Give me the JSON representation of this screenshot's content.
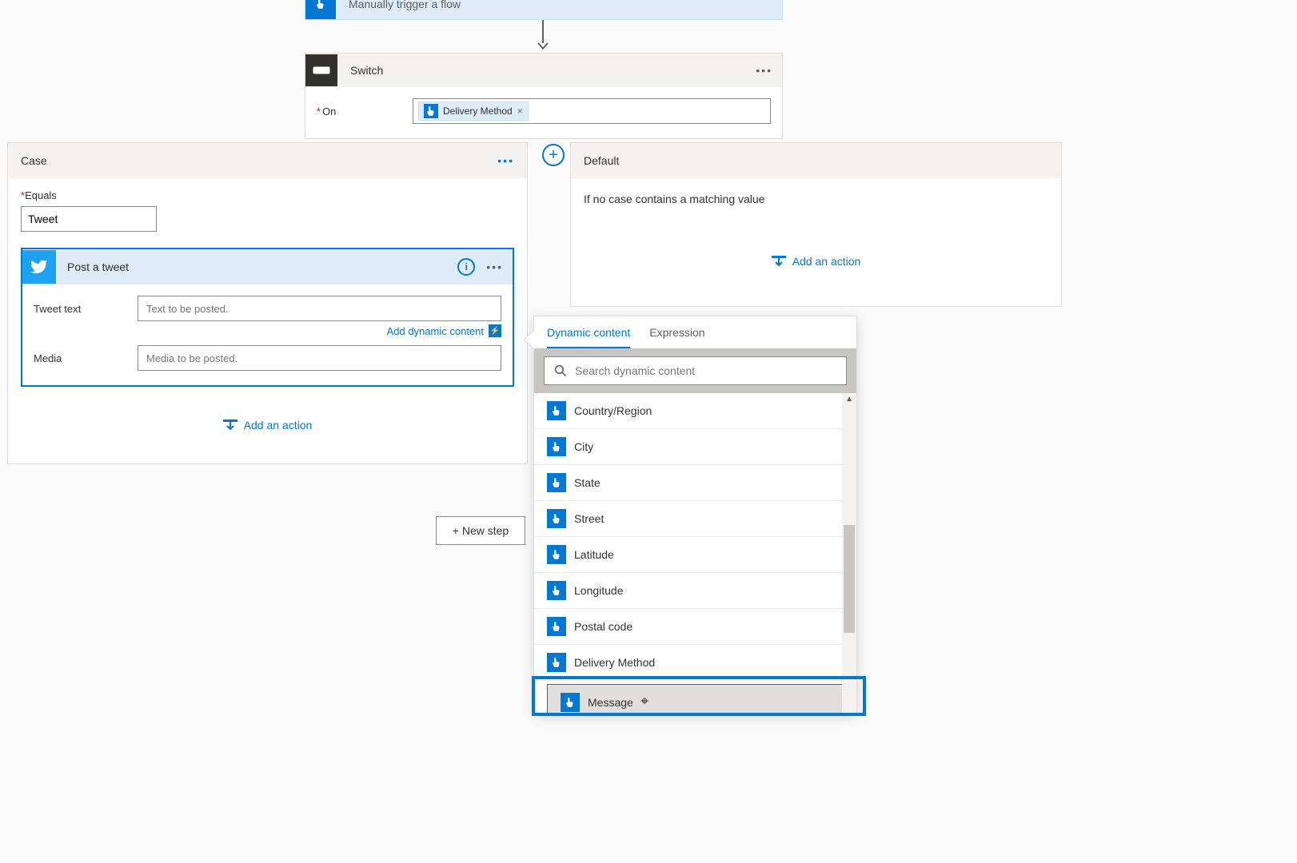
{
  "trigger": {
    "label": "Manually trigger a flow"
  },
  "switch": {
    "title": "Switch",
    "onLabel": "On",
    "chip": "Delivery Method"
  },
  "case": {
    "title": "Case",
    "eqLabel": "Equals",
    "eqValue": "Tweet",
    "tweet": {
      "title": "Post a tweet",
      "row1": "Tweet text",
      "ph1": "Text to be posted.",
      "row2": "Media",
      "ph2": "Media to be posted.",
      "dyn": "Add dynamic content"
    },
    "addAction": "Add an action"
  },
  "defaultCard": {
    "title": "Default",
    "text": "If no case contains a matching value",
    "addAction": "Add an action"
  },
  "newStep": "+ New step",
  "dynPanel": {
    "tabs": [
      "Dynamic content",
      "Expression"
    ],
    "searchPh": "Search dynamic content",
    "items": [
      "Country/Region",
      "City",
      "State",
      "Street",
      "Latitude",
      "Longitude",
      "Postal code",
      "Delivery Method",
      "Message"
    ]
  }
}
